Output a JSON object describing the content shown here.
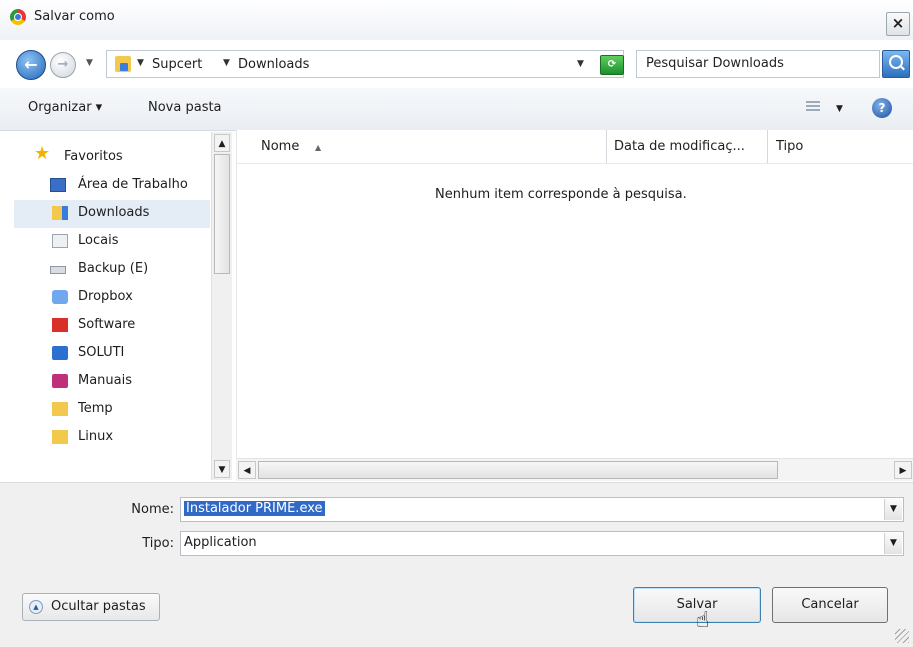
{
  "window": {
    "title": "Salvar como",
    "close_label": "×"
  },
  "address": {
    "back_glyph": "←",
    "fwd_glyph": "→",
    "breadcrumbs": [
      "Supcert",
      "Downloads"
    ],
    "refresh_glyph": "⟳",
    "search_placeholder": "Pesquisar Downloads"
  },
  "toolbar": {
    "organize_label": "Organizar ▾",
    "new_folder_label": "Nova pasta",
    "help_glyph": "?"
  },
  "nav": {
    "favorites_label": "Favoritos",
    "items": [
      {
        "label": "Área de Trabalho",
        "icon": "desktop-icon",
        "color": "#3b6fc7"
      },
      {
        "label": "Downloads",
        "icon": "downloads-folder-icon",
        "color": "#f2c94c",
        "selected": true
      },
      {
        "label": "Locais",
        "icon": "recent-places-icon",
        "color": "#9aa6b4"
      },
      {
        "label": "Backup (E)",
        "icon": "drive-icon",
        "color": "#b9c0c8"
      },
      {
        "label": "Dropbox",
        "icon": "dropbox-icon",
        "color": "#4b8fe0"
      },
      {
        "label": "Software",
        "icon": "red-folder-icon",
        "color": "#d9302a"
      },
      {
        "label": "SOLUTI",
        "icon": "blue-folder-icon",
        "color": "#2c6fd1"
      },
      {
        "label": "Manuais",
        "icon": "pink-folder-icon",
        "color": "#c0307a"
      },
      {
        "label": "Temp",
        "icon": "folder-icon",
        "color": "#f2c94c"
      },
      {
        "label": "Linux",
        "icon": "folder-icon",
        "color": "#f2c94c"
      }
    ]
  },
  "filelist": {
    "columns": [
      "Nome",
      "Data de modificaç...",
      "Tipo"
    ],
    "sort_glyph": "▲",
    "empty_message": "Nenhum item corresponde à pesquisa."
  },
  "form": {
    "name_label": "Nome:",
    "name_value": "Instalador PRIME.exe",
    "type_label": "Tipo:",
    "type_value": "Application"
  },
  "buttons": {
    "hide_folders_label": "Ocultar pastas",
    "save_label": "Salvar",
    "cancel_label": "Cancelar"
  }
}
